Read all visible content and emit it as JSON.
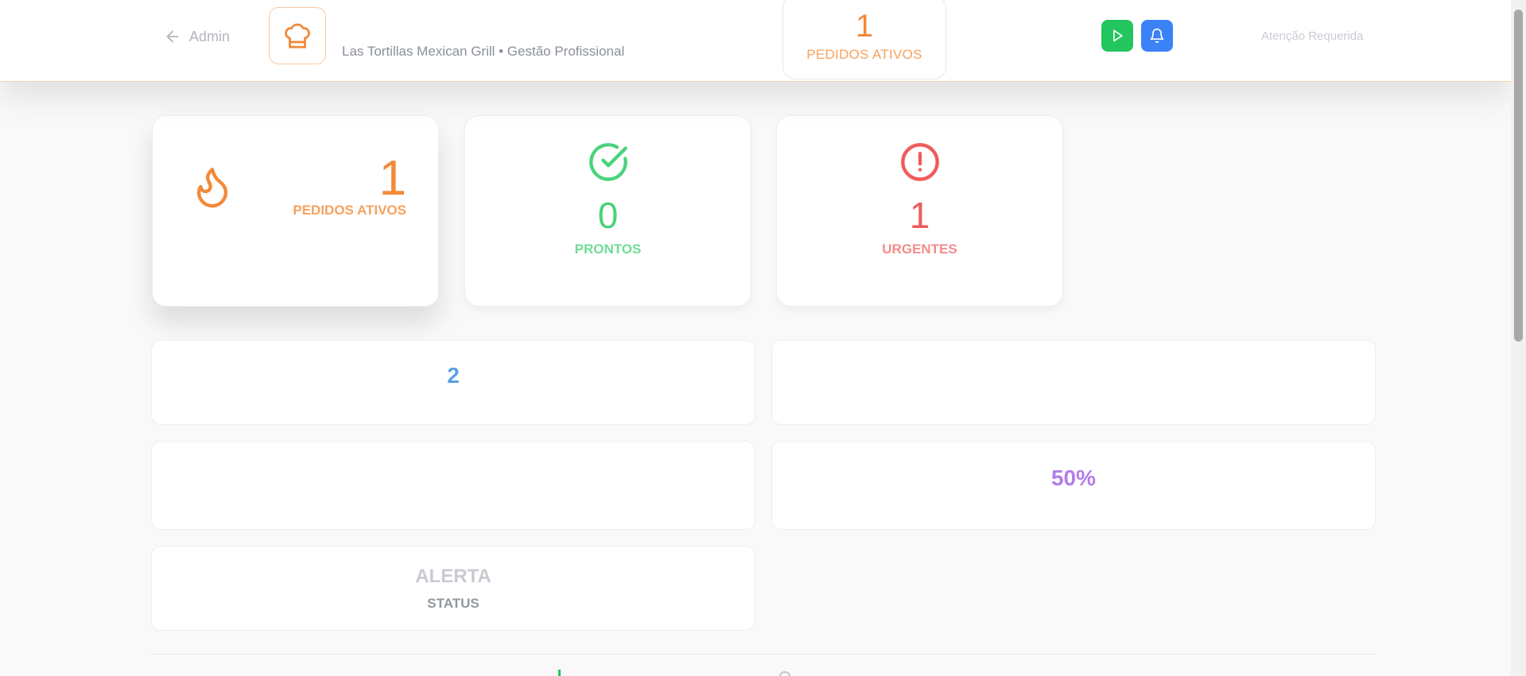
{
  "header": {
    "back_label": "Admin",
    "subtitle": "Las Tortillas Mexican Grill • Gestão Profissional",
    "active_count": "1",
    "active_label": "PEDIDOS ATIVOS",
    "attention_label": "Atenção Requerida",
    "icons": {
      "back": "arrow-left-icon",
      "logo": "chef-hat-icon",
      "play": "play-icon",
      "bell": "bell-icon"
    }
  },
  "stats": {
    "active": {
      "value": "1",
      "label": "PEDIDOS ATIVOS",
      "icon": "flame-icon",
      "color": "#f28a3a"
    },
    "ready": {
      "value": "0",
      "label": "PRONTOS",
      "icon": "check-circle-icon",
      "color": "#4ad27b"
    },
    "urgent": {
      "value": "1",
      "label": "URGENTES",
      "icon": "alert-circle-icon",
      "color": "#ef5b5b"
    }
  },
  "panels": {
    "p1": {
      "value": "2"
    },
    "p4": {
      "value": "50%"
    },
    "p5": {
      "value": "ALERTA",
      "sub": "STATUS"
    }
  },
  "colors": {
    "accent_orange": "#f28a3a",
    "green": "#22c55e",
    "blue": "#3b82f6",
    "purple": "#b27de8"
  }
}
